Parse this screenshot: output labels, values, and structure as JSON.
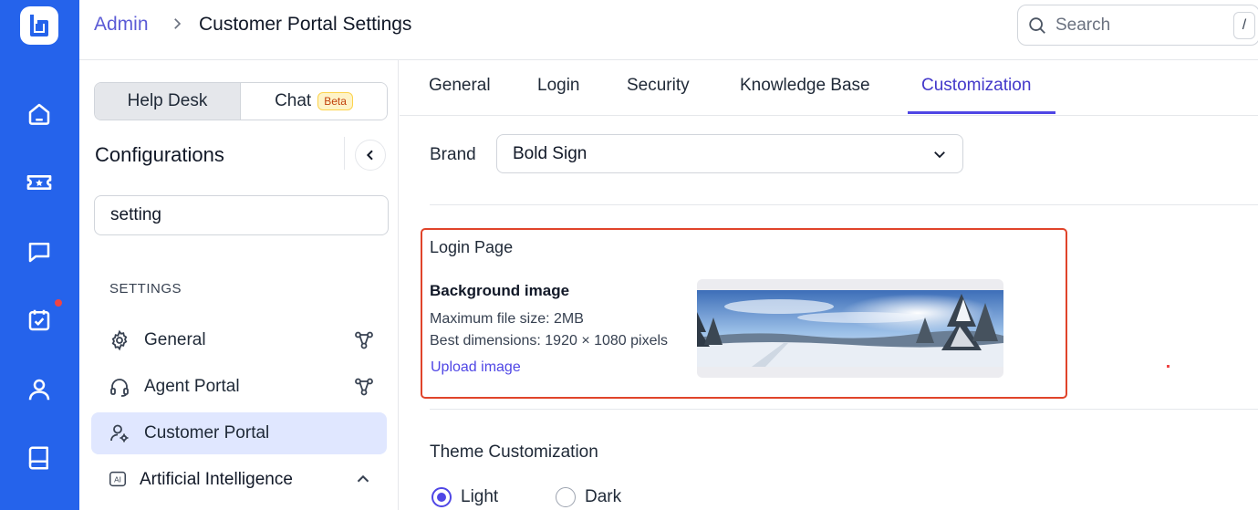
{
  "colors": {
    "rail": "#2563eb",
    "accent": "#4f46e5",
    "highlight_border": "#e0442a",
    "notification": "#ef4444"
  },
  "rail": {
    "items": [
      {
        "icon": "home-icon"
      },
      {
        "icon": "ticket-icon"
      },
      {
        "icon": "chat-icon"
      },
      {
        "icon": "tasks-icon",
        "has_notification": true
      },
      {
        "icon": "contacts-icon"
      },
      {
        "icon": "knowledge-base-icon"
      }
    ]
  },
  "header": {
    "breadcrumb_root": "Admin",
    "page_title": "Customer Portal Settings",
    "search_placeholder": "Search",
    "search_shortcut": "/"
  },
  "sidebar": {
    "toggle": {
      "help_desk": "Help Desk",
      "chat": "Chat",
      "chat_badge": "Beta"
    },
    "title": "Configurations",
    "filter_value": "setting",
    "section_label": "SETTINGS",
    "items": [
      {
        "label": "General",
        "icon": "gear-icon",
        "side_icon": "workflow-icon"
      },
      {
        "label": "Agent Portal",
        "icon": "headset-icon",
        "side_icon": "workflow-icon"
      },
      {
        "label": "Customer Portal",
        "icon": "user-settings-icon",
        "active": true
      },
      {
        "label": "Artificial Intelligence",
        "icon": "ai-icon",
        "side_icon": "chevron-up-icon"
      }
    ]
  },
  "tabs": [
    {
      "label": "General"
    },
    {
      "label": "Login"
    },
    {
      "label": "Security"
    },
    {
      "label": "Knowledge Base"
    },
    {
      "label": "Customization",
      "active": true
    }
  ],
  "content": {
    "brand_label": "Brand",
    "brand_value": "Bold Sign",
    "login_page": {
      "title": "Login Page",
      "bg_title": "Background image",
      "max_size": "Maximum file size: 2MB",
      "dimensions": "Best dimensions: 1920 × 1080 pixels",
      "upload_label": "Upload image"
    },
    "theme": {
      "title": "Theme Customization",
      "options": [
        {
          "label": "Light",
          "selected": true
        },
        {
          "label": "Dark",
          "selected": false
        }
      ]
    }
  }
}
